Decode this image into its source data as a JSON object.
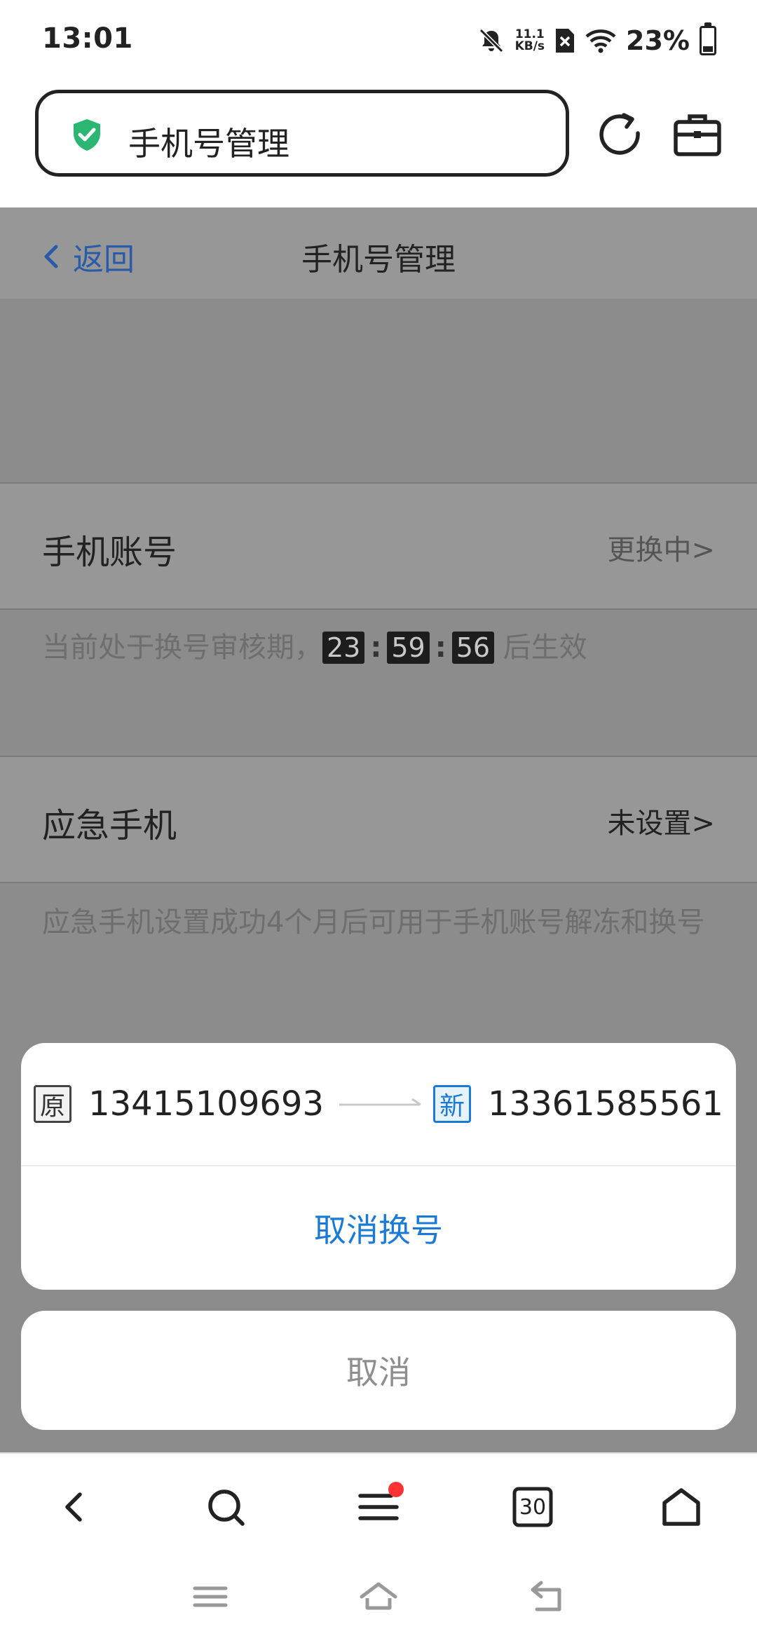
{
  "status_bar": {
    "time": "13:01",
    "net_speed_top": "11.1",
    "net_speed_bottom": "KB/s",
    "battery": "23%",
    "battery_level": 0.23
  },
  "browser": {
    "address_title": "手机号管理",
    "icons": [
      "shield-check-icon",
      "reload-icon",
      "toolbox-icon"
    ]
  },
  "page": {
    "back_label": "返回",
    "title": "手机号管理",
    "phone_account": {
      "label": "手机账号",
      "value": "更换中>"
    },
    "review_notice": {
      "prefix": "当前处于换号审核期，",
      "hours": "23",
      "minutes": "59",
      "seconds": "56",
      "colon": ":",
      "suffix": "后生效"
    },
    "emergency_phone": {
      "label": "应急手机",
      "value": "未设置>",
      "description": "应急手机设置成功4个月后可用于手机账号解冻和换号"
    }
  },
  "sheet": {
    "old_tag": "原",
    "old_number": "13415109693",
    "new_tag": "新",
    "new_number": "13361585561",
    "cancel_change_label": "取消换号",
    "cancel_label": "取消"
  },
  "bottom_toolbar": {
    "tabs_count": "30"
  },
  "colors": {
    "accent_blue": "#1a7ad6",
    "back_blue": "#2a5ba8",
    "shield_green": "#2bb673",
    "notification_dot": "#ff3333"
  }
}
